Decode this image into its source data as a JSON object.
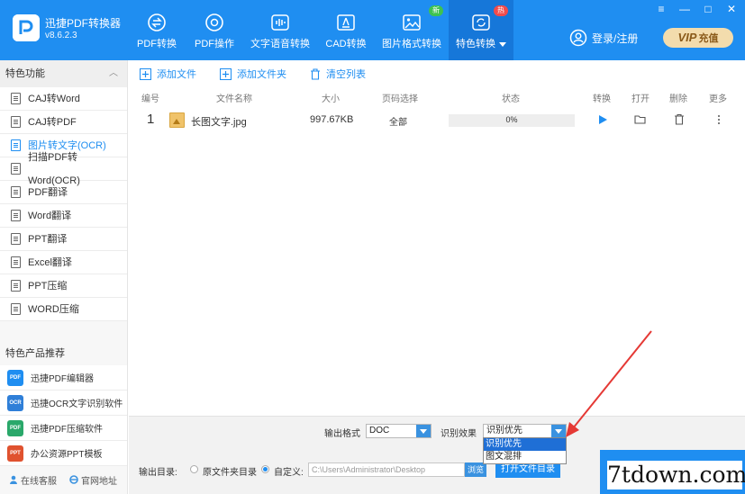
{
  "app": {
    "name": "迅捷PDF转换器",
    "version": "v8.6.2.3"
  },
  "nav": [
    {
      "label": "PDF转换",
      "icon": "convert-icon"
    },
    {
      "label": "PDF操作",
      "icon": "gear-icon"
    },
    {
      "label": "文字语音转换",
      "icon": "audio-wave-icon"
    },
    {
      "label": "CAD转换",
      "icon": "cad-icon"
    },
    {
      "label": "图片格式转换",
      "icon": "image-icon",
      "badge": "新"
    },
    {
      "label": "特色转换",
      "icon": "special-icon",
      "badge": "热"
    }
  ],
  "header": {
    "login": "登录/注册",
    "vip_big": "VIP",
    "vip_small": "充值",
    "controls": [
      "≡",
      "—",
      "□",
      "✕"
    ]
  },
  "sidebar": {
    "title": "特色功能",
    "collapse": "︿",
    "items": [
      {
        "label": "CAJ转Word"
      },
      {
        "label": "CAJ转PDF"
      },
      {
        "label": "图片转文字(OCR)",
        "active": true
      },
      {
        "label": "扫描PDF转Word(OCR)"
      },
      {
        "label": "PDF翻译"
      },
      {
        "label": "Word翻译"
      },
      {
        "label": "PPT翻译"
      },
      {
        "label": "Excel翻译"
      },
      {
        "label": "PPT压缩"
      },
      {
        "label": "WORD压缩"
      }
    ],
    "promo_title": "特色产品推荐",
    "promos": [
      {
        "label": "迅捷PDF编辑器",
        "color": "#1f8ef1",
        "tag": "PDF"
      },
      {
        "label": "迅捷OCR文字识别软件",
        "color": "#2f7fd8",
        "tag": "OCR"
      },
      {
        "label": "迅捷PDF压缩软件",
        "color": "#2aa86a",
        "tag": "PDF"
      },
      {
        "label": "办公资源PPT模板",
        "color": "#e0522f",
        "tag": "PPT"
      }
    ],
    "footer": {
      "service": "在线客服",
      "website": "官网地址"
    }
  },
  "toolbar": {
    "add_file": "添加文件",
    "add_folder": "添加文件夹",
    "clear": "清空列表"
  },
  "table": {
    "headers": {
      "num": "编号",
      "name": "文件名称",
      "size": "大小",
      "pages": "页码选择",
      "status": "状态",
      "convert": "转换",
      "open": "打开",
      "delete": "删除",
      "more": "更多"
    },
    "rows": [
      {
        "num": "1",
        "name": "长图文字.jpg",
        "size": "997.67KB",
        "pages": "全部",
        "progress": 0,
        "status": "0%"
      }
    ]
  },
  "bottom": {
    "format_label": "输出格式",
    "format_value": "DOC",
    "recognition_label": "识别效果",
    "recognition_value": "识别优先",
    "recognition_options": [
      "识别优先",
      "图文混排"
    ],
    "output_label": "输出目录:",
    "radio_original": "原文件夹目录",
    "radio_custom": "自定义:",
    "path": "C:\\Users\\Administrator\\Desktop",
    "browse": "浏览",
    "open_dir": "打开文件目录"
  },
  "watermark": "7tdown.com",
  "colors": {
    "primary": "#1f8ef1",
    "active_nav": "#1677d9",
    "vip_bg": "#f3dcad",
    "annotation": "#e53935"
  }
}
